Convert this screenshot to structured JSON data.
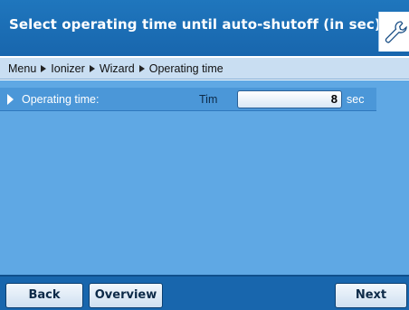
{
  "header": {
    "title": "Select operating time until auto-shutoff (in sec):",
    "icon": "wrench-icon"
  },
  "breadcrumb": {
    "items": [
      "Menu",
      "Ionizer",
      "Wizard",
      "Operating time"
    ]
  },
  "parameter": {
    "label": "Operating time:",
    "field_name": "Tim",
    "value": "8",
    "unit": "sec"
  },
  "footer": {
    "back_label": "Back",
    "overview_label": "Overview",
    "next_label": "Next"
  },
  "colors": {
    "title_bar": "#1a6fb5",
    "content_bg": "#5fa8e4",
    "breadcrumb_bg": "#c9def2"
  }
}
